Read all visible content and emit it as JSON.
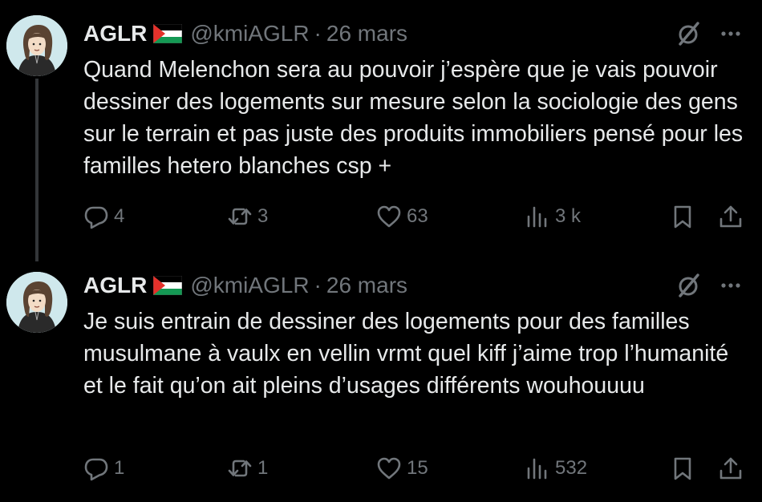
{
  "tweets": [
    {
      "author_name": "AGLR",
      "handle": "@kmiAGLR",
      "separator": "·",
      "date": "26 mars",
      "text": "Quand Melenchon sera au pouvoir j’espère que je vais pouvoir dessiner des logements sur mesure selon la sociologie des gens sur le terrain et pas juste des produits immobiliers pensé pour les familles hetero blanches csp +",
      "replies": "4",
      "retweets": "3",
      "likes": "63",
      "views": "3 k"
    },
    {
      "author_name": "AGLR",
      "handle": "@kmiAGLR",
      "separator": "·",
      "date": "26 mars",
      "text": "Je suis entrain de dessiner des logements pour des familles musulmane à vaulx en vellin vrmt quel kiff j’aime trop l’humanité et le fait qu’on ait pleins d’usages différents wouhouuuu",
      "replies": "1",
      "retweets": "1",
      "likes": "15",
      "views": "532"
    }
  ],
  "icons": {
    "flag": "palestine-flag-icon",
    "grok": "grok-icon",
    "more": "more-horizontal-icon",
    "reply": "reply-icon",
    "retweet": "retweet-icon",
    "like": "like-icon",
    "views": "views-icon",
    "bookmark": "bookmark-icon",
    "share": "share-icon"
  },
  "colors": {
    "background": "#000000",
    "primary_text": "#e7e9ea",
    "secondary_text": "#71767b",
    "thread_line": "#333639"
  }
}
